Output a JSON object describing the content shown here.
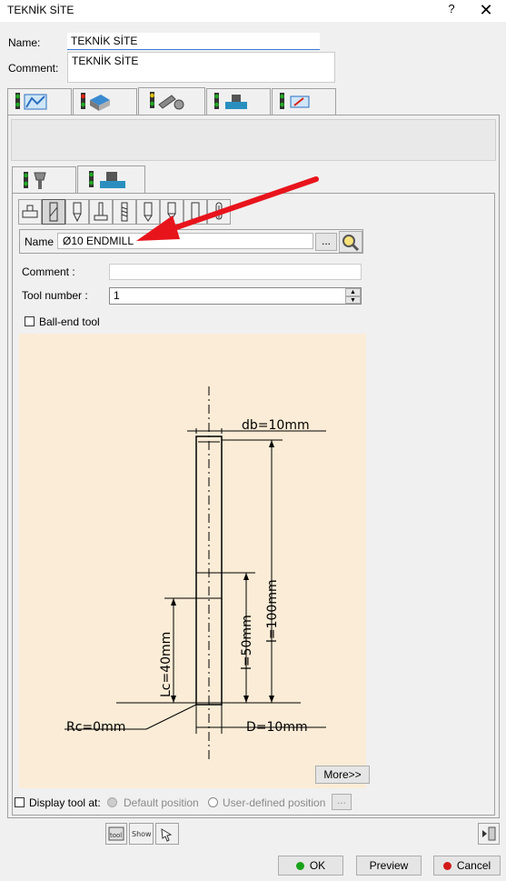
{
  "window": {
    "title": "TEKNİK SİTE",
    "help": "?",
    "close": "✕"
  },
  "form": {
    "name_label": "Name:",
    "name_value": "TEKNİK SİTE",
    "comment_label": "Comment:",
    "comment_value": "TEKNİK SİTE"
  },
  "top_tabs": [
    {
      "icon": "strategy-icon"
    },
    {
      "icon": "geometry-icon"
    },
    {
      "icon": "tool-icon"
    },
    {
      "icon": "feeds-speeds-icon"
    },
    {
      "icon": "macros-icon"
    }
  ],
  "sub_tabs": [
    {
      "icon": "tool-assembly-icon"
    },
    {
      "icon": "machine-icon"
    }
  ],
  "tool": {
    "name_label": "Name",
    "name_value": "Ø10 ENDMILL",
    "browse_label": "...",
    "comment_label": "Comment :",
    "comment_value": "",
    "number_label": "Tool number :",
    "number_value": "1",
    "ball_end_label": "Ball-end tool"
  },
  "drawing": {
    "db": "db=10mm",
    "l": "l=100mm",
    "ls": "l=50mm",
    "lc": "Lc=40mm",
    "rc": "Rc=0mm",
    "d": "D=10mm"
  },
  "more_button": "More>>",
  "display": {
    "label": "Display tool at:",
    "default": "Default position",
    "user": "User-defined position",
    "browse": "..."
  },
  "buttons": {
    "ok": "OK",
    "preview": "Preview",
    "cancel": "Cancel"
  },
  "colors": {
    "drawing_bg": "#faecd6",
    "arrow": "#e8141c"
  }
}
